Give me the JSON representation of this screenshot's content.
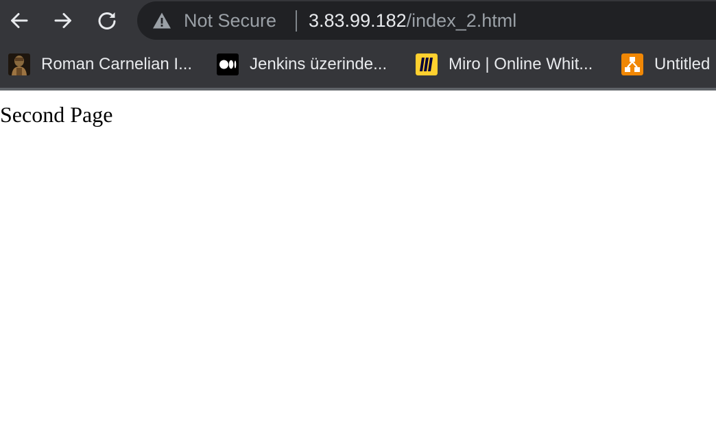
{
  "toolbar": {
    "back_icon": "arrow-left-icon",
    "forward_icon": "arrow-right-icon",
    "reload_icon": "reload-icon"
  },
  "omnibox": {
    "security_icon": "warning-triangle-icon",
    "security_label": "Not Secure",
    "url_host": "3.83.99.182",
    "url_path": "/index_2.html"
  },
  "bookmarks": [
    {
      "label": "Roman Carnelian I...",
      "icon": "portrait-favicon"
    },
    {
      "label": "Jenkins üzerinde...",
      "icon": "medium-favicon"
    },
    {
      "label": "Miro | Online Whit...",
      "icon": "miro-favicon"
    },
    {
      "label": "Untitled",
      "icon": "diagram-favicon"
    }
  ],
  "colors": {
    "chrome_bg": "#35363a",
    "omnibox_bg": "#202124",
    "text_primary": "#e8eaed",
    "text_secondary": "#9aa0a6",
    "miro_yellow": "#ffd02f",
    "diagram_orange": "#f08705"
  },
  "page": {
    "heading": "Second Page"
  }
}
